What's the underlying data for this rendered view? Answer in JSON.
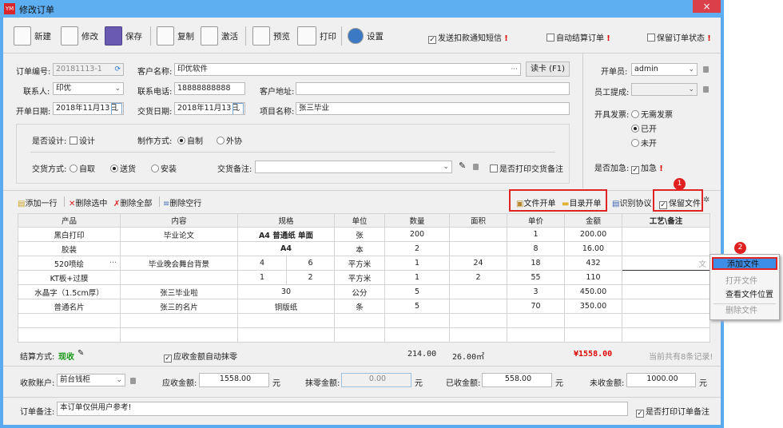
{
  "window": {
    "title": "修改订单",
    "close": "×"
  },
  "toolbar": {
    "new": "新建",
    "edit": "修改",
    "save": "保存",
    "copy": "复制",
    "activate": "激活",
    "preview": "预览",
    "print": "打印",
    "settings": "设置",
    "send_sms": "发送扣款通知短信",
    "auto_settle": "自动结算订单",
    "keep_status": "保留订单状态",
    "warn": "!"
  },
  "form": {
    "order_no_label": "订单编号:",
    "order_no": "20181113-1",
    "customer_label": "客户名称:",
    "customer": "印优软件",
    "more": "···",
    "read_card": "读卡 (F1)",
    "contact_label": "联系人:",
    "contact": "印优",
    "phone_label": "联系电话:",
    "phone": "18888888888",
    "address_label": "客户地址:",
    "address": "",
    "open_date_label": "开单日期:",
    "open_date": "2018年11月13日",
    "delivery_date_label": "交货日期:",
    "delivery_date": "2018年11月13日",
    "project_label": "项目名称:",
    "project": "张三毕业",
    "design_label": "是否设计:",
    "design_opt": "设计",
    "make_label": "制作方式:",
    "make_self": "自制",
    "make_out": "外协",
    "delivery_mode_label": "交货方式:",
    "dm_pickup": "自取",
    "dm_deliver": "送货",
    "dm_install": "安装",
    "delivery_note_label": "交货备注:",
    "delivery_note": "",
    "print_delivery_note": "是否打印交货备注"
  },
  "right": {
    "clerk_label": "开单员:",
    "clerk": "admin",
    "commission_label": "员工提成:",
    "commission": "",
    "invoice_label": "开具发票:",
    "inv_none": "无需发票",
    "inv_done": "已开",
    "inv_not": "未开",
    "urgent_label": "是否加急:",
    "urgent": "加急"
  },
  "rowbar": {
    "add_row": "添加一行",
    "del_sel": "删除选中",
    "del_all": "删除全部",
    "del_empty": "删除空行",
    "file_order": "文件开单",
    "dir_order": "目录开单",
    "identify": "识别协议",
    "keep_file": "保留文件"
  },
  "table": {
    "headers": [
      "产品",
      "内容",
      "规格",
      "单位",
      "数量",
      "面积",
      "单价",
      "金额",
      "工艺\\备注"
    ],
    "rows": [
      {
        "product": "黑白打印",
        "content": "毕业论文",
        "spec": "A4 普通纸 单面",
        "unit": "张",
        "qty": "200",
        "area": "",
        "price": "1",
        "amount": "200.00",
        "note": ""
      },
      {
        "product": "胶装",
        "content": "",
        "spec": "A4",
        "unit": "本",
        "qty": "2",
        "area": "",
        "price": "8",
        "amount": "16.00",
        "note": ""
      },
      {
        "product": "520喷绘",
        "content": "毕业晚会舞台背景",
        "spec_w": "4",
        "spec_h": "6",
        "unit": "平方米",
        "qty": "1",
        "area": "24",
        "price": "18",
        "amount": "432",
        "note": "",
        "note_hint": "文"
      },
      {
        "product": "KT板+过膜",
        "content": "",
        "spec_w": "1",
        "spec_h": "2",
        "unit": "平方米",
        "qty": "1",
        "area": "2",
        "price": "55",
        "amount": "110",
        "note": ""
      },
      {
        "product": "水晶字（1.5cm厚）",
        "content": "张三毕业啦",
        "spec": "30",
        "unit": "公分",
        "qty": "5",
        "area": "",
        "price": "3",
        "amount": "450.00",
        "note": ""
      },
      {
        "product": "普通名片",
        "content": "张三的名片",
        "spec": "铜版纸",
        "unit": "条",
        "qty": "5",
        "area": "",
        "price": "70",
        "amount": "350.00",
        "note": ""
      }
    ]
  },
  "summary": {
    "settle_label": "结算方式:",
    "settle": "现收",
    "auto_round": "应收金额自动抹零",
    "qty_total": "214.00",
    "area_total": "26.00㎡",
    "amount_total": "¥1558.00",
    "records": "当前共有8条记录!"
  },
  "payment": {
    "account_label": "收款账户:",
    "account": "前台钱柜",
    "receivable_label": "应收金额:",
    "receivable": "1558.00",
    "round_label": "抹零金额:",
    "round": "0.00",
    "received_label": "已收金额:",
    "received": "558.00",
    "unpaid_label": "未收金额:",
    "unpaid": "1000.00",
    "yuan": "元"
  },
  "remark": {
    "label": "订单备注:",
    "value": "本订单仅供用户参考!",
    "print": "是否打印订单备注"
  },
  "context_menu": {
    "items": [
      "添加文件",
      "打开文件",
      "查看文件位置",
      "删除文件"
    ]
  },
  "callouts": [
    "1",
    "2"
  ],
  "colors": {
    "title_bar": "#5eaef2",
    "highlight": "#e02424",
    "menu_active": "#3d8ee6",
    "total_red": "#d00000",
    "settle_green": "#1a9a1a"
  }
}
